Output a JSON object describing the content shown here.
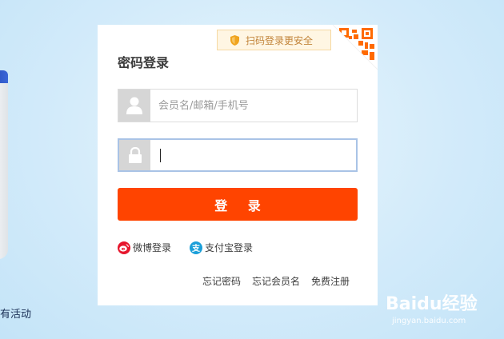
{
  "side": {
    "activity_text": "有活动"
  },
  "login": {
    "title": "密码登录",
    "qr_hint": "扫码登录更安全",
    "username_placeholder": "会员名/邮箱/手机号",
    "password_value": "",
    "submit_label": "登 录",
    "weibo_label": "微博登录",
    "alipay_label": "支付宝登录",
    "alipay_icon_char": "支",
    "links": {
      "forgot_password": "忘记密码",
      "forgot_username": "忘记会员名",
      "register": "免费注册"
    }
  },
  "watermark": {
    "logo": "Baidu经验",
    "url": "jingyan.baidu.com"
  },
  "colors": {
    "accent": "#ff4400",
    "input_focus_border": "#a9c3e6",
    "qr_orange": "#ff6a00"
  },
  "icons": [
    "shield-icon",
    "qr-code-icon",
    "user-icon",
    "lock-icon",
    "weibo-icon",
    "alipay-icon"
  ]
}
